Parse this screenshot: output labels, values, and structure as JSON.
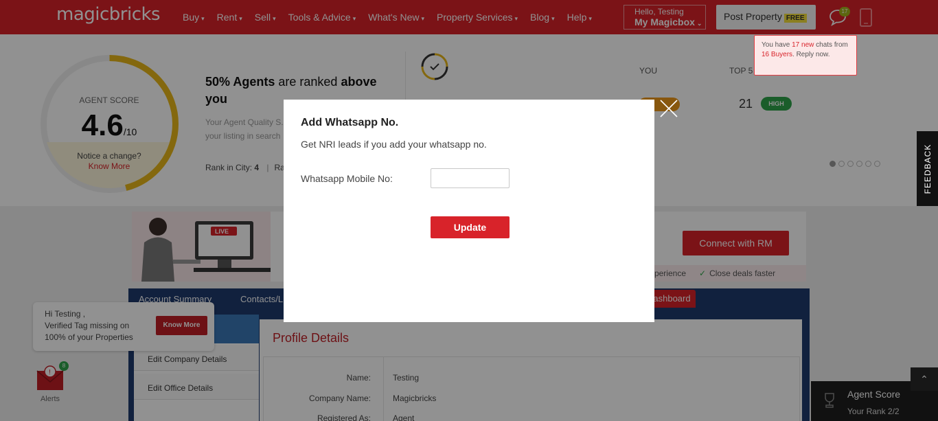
{
  "header": {
    "logo": "magicbricks",
    "nav": [
      {
        "label": "Buy"
      },
      {
        "label": "Rent"
      },
      {
        "label": "Sell"
      },
      {
        "label": "Tools & Advice"
      },
      {
        "label": "What's New"
      },
      {
        "label": "Property Services"
      },
      {
        "label": "Blog"
      },
      {
        "label": "Help"
      }
    ],
    "hello_small": "Hello, Testing",
    "hello_big": "My Magicbox",
    "post_property": "Post Property",
    "free_tag": "FREE",
    "chat_count": "17",
    "chat_popup": {
      "t1": "You have ",
      "new_chats": "17 new",
      "t2": " chats from ",
      "buyers": "16 Buyers",
      "t3": ". Reply now."
    }
  },
  "score": {
    "label": "AGENT SCORE",
    "value": "4.6",
    "out_of": "/10",
    "score_fraction": 0.46,
    "notice": "Notice a change?",
    "know_more": "Know More",
    "ranked_pct": "50% Agents",
    "ranked_mid": " are ranked ",
    "ranked_bold": "above",
    "ranked_end": "you",
    "quality_text": "Your Agent Quality S... your listing in search",
    "rank_city_label": "Rank in City: ",
    "rank_city_value": "4",
    "rank_next": "Ra",
    "you_label": "YOU",
    "top5_label": "TOP 5",
    "top5_value": "21",
    "high_tag": "HIGH",
    "slider_dots": 6,
    "slider_active": 0
  },
  "banner": {
    "live_tag": "LIVE",
    "connect_btn": "Connect with RM",
    "benefit1": "experience",
    "benefit2": "Close deals faster"
  },
  "tabs": {
    "account_summary": "Account Summary",
    "contacts": "Contacts/L",
    "dashboard": "Dashboard"
  },
  "side_menu": {
    "items": [
      "Edit Company Details",
      "Edit Office Details"
    ]
  },
  "profile": {
    "title": "Profile Details",
    "rows": [
      {
        "label": "Name:",
        "value": "Testing"
      },
      {
        "label": "Company Name:",
        "value": "Magicbricks"
      },
      {
        "label": "Registered As:",
        "value": "Agent"
      }
    ]
  },
  "hi_card": {
    "line1": "Hi Testing ,",
    "line2": "Verified Tag missing on",
    "line3": "100% of your Properties",
    "button": "Know More"
  },
  "alerts": {
    "label": "Alerts",
    "count": "8"
  },
  "feedback": "FEEDBACK",
  "score_card": {
    "title": "Agent Score",
    "rank": "Your Rank 2/2"
  },
  "modal": {
    "title": "Add Whatsapp No.",
    "subtitle": "Get NRI leads if you add your whatsapp no.",
    "field_label": "Whatsapp Mobile No:",
    "field_value": "",
    "field_placeholder": "",
    "button": "Update"
  },
  "colors": {
    "brand": "#d8232a",
    "score_ring": "#e8b81a",
    "navy": "#1e3a6e",
    "high": "#2ea44a"
  }
}
